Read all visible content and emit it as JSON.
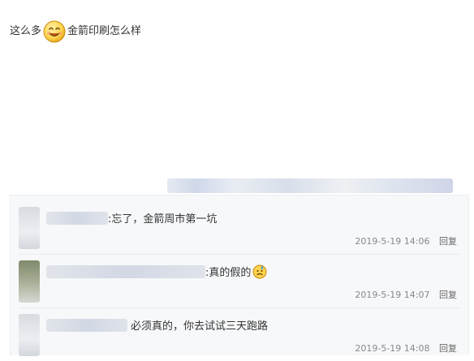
{
  "post": {
    "before_emoji": "这么多",
    "after_emoji": "金箭印刷怎么样"
  },
  "comments": [
    {
      "text": ":忘了，金箭周市第一坑",
      "time": "2019-5-19 14:06",
      "reply": "回复"
    },
    {
      "text": ":真的假的",
      "time": "2019-5-19 14:07",
      "reply": "回复"
    },
    {
      "text": "必须真的，你去试试三天跑路",
      "time": "2019-5-19 14:08",
      "reply": "回复"
    }
  ],
  "icons": {
    "smile_emoji": "smile-emoji-icon",
    "sweat_emoji": "sweat-emoji-icon"
  }
}
